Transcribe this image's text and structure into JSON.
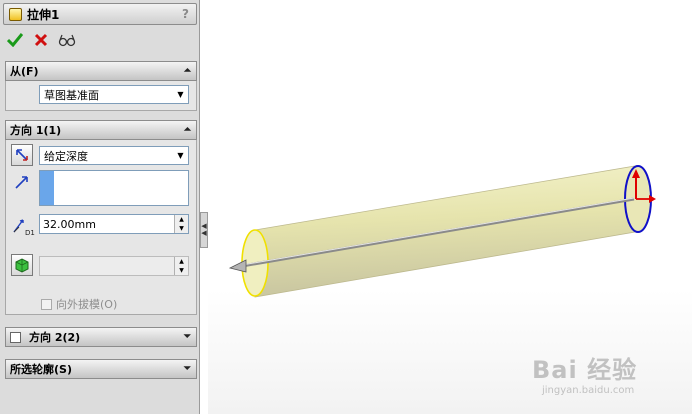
{
  "panel": {
    "title": "拉伸1",
    "help": "?",
    "from_group": {
      "title": "从(F)",
      "value": "草图基准面"
    },
    "direction1": {
      "title": "方向 1(1)",
      "end_condition": "给定深度",
      "depth": "32.00mm",
      "draft_outward_label": "向外拔模(O)"
    },
    "direction2": {
      "title": "方向 2(2)"
    },
    "selected_contours": {
      "title": "所选轮廓(S)"
    }
  },
  "icons": {
    "confirm": "check-icon",
    "cancel": "close-icon",
    "preview": "glasses-icon",
    "collapse": "chevron-up-double-icon",
    "expand": "chevron-down-double-icon"
  },
  "colors": {
    "confirm_green": "#1a9a1a",
    "cancel_red": "#d01010",
    "cylinder_yellow": "#efeeb8",
    "edge_blue": "#1010c8"
  },
  "watermark": {
    "brand": "Bai 经验",
    "url": "jingyan.baidu.com"
  }
}
